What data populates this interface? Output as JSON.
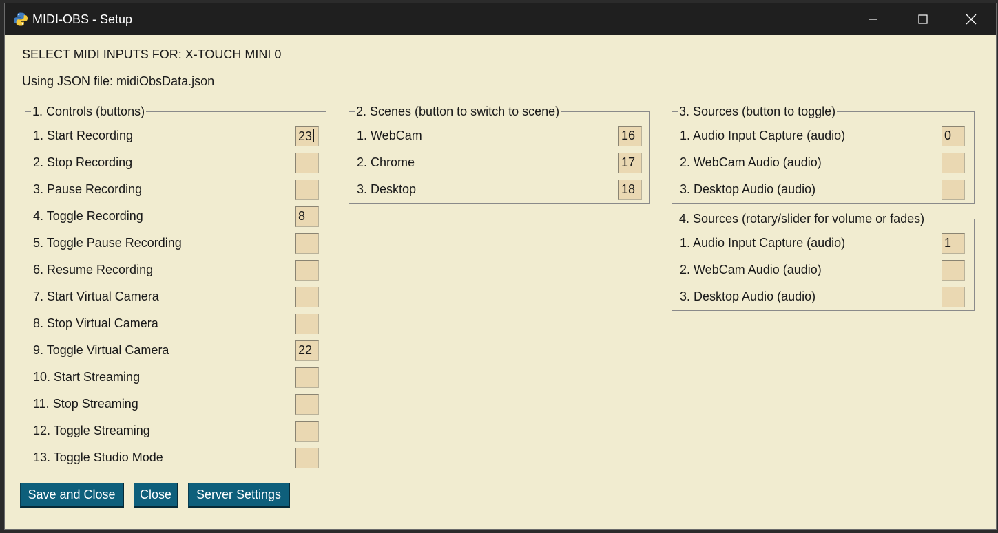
{
  "window": {
    "title": "MIDI-OBS - Setup",
    "icons": {
      "app": "python-icon",
      "minimize": "minimize-icon",
      "maximize": "maximize-icon",
      "close": "close-icon"
    }
  },
  "header": {
    "select_line": "SELECT MIDI INPUTS FOR: X-TOUCH MINI 0",
    "json_line": "Using JSON file: midiObsData.json"
  },
  "controls": {
    "title": "1. Controls (buttons)",
    "rows": [
      {
        "label": "1. Start Recording",
        "value": "23"
      },
      {
        "label": "2. Stop Recording",
        "value": ""
      },
      {
        "label": "3. Pause Recording",
        "value": ""
      },
      {
        "label": "4. Toggle Recording",
        "value": "8"
      },
      {
        "label": "5. Toggle Pause Recording",
        "value": ""
      },
      {
        "label": "6. Resume Recording",
        "value": ""
      },
      {
        "label": "7. Start Virtual Camera",
        "value": ""
      },
      {
        "label": "8. Stop Virtual Camera",
        "value": ""
      },
      {
        "label": "9. Toggle Virtual Camera",
        "value": "22"
      },
      {
        "label": "10. Start Streaming",
        "value": ""
      },
      {
        "label": "11. Stop Streaming",
        "value": ""
      },
      {
        "label": "12. Toggle Streaming",
        "value": ""
      },
      {
        "label": "13. Toggle Studio Mode",
        "value": ""
      }
    ]
  },
  "scenes": {
    "title": "2. Scenes (button to switch to scene)",
    "rows": [
      {
        "label": "1. WebCam",
        "value": "16"
      },
      {
        "label": "2. Chrome",
        "value": "17"
      },
      {
        "label": "3. Desktop",
        "value": "18"
      }
    ]
  },
  "sources_toggle": {
    "title": "3. Sources (button to toggle)",
    "rows": [
      {
        "label": "1. Audio Input Capture (audio)",
        "value": "0"
      },
      {
        "label": "2. WebCam Audio (audio)",
        "value": ""
      },
      {
        "label": "3. Desktop Audio (audio)",
        "value": ""
      }
    ]
  },
  "sources_volume": {
    "title": "4. Sources (rotary/slider for volume or fades)",
    "rows": [
      {
        "label": "1. Audio Input Capture (audio)",
        "value": "1"
      },
      {
        "label": "2. WebCam Audio (audio)",
        "value": ""
      },
      {
        "label": "3. Desktop Audio (audio)",
        "value": ""
      }
    ]
  },
  "buttons": {
    "save_close": "Save and Close",
    "close": "Close",
    "server_settings": "Server Settings"
  },
  "colors": {
    "window_bg": "#f1ecd0",
    "input_bg": "#ead8b2",
    "button_bg": "#0e5f7b",
    "titlebar_bg": "#1f1f1f"
  }
}
